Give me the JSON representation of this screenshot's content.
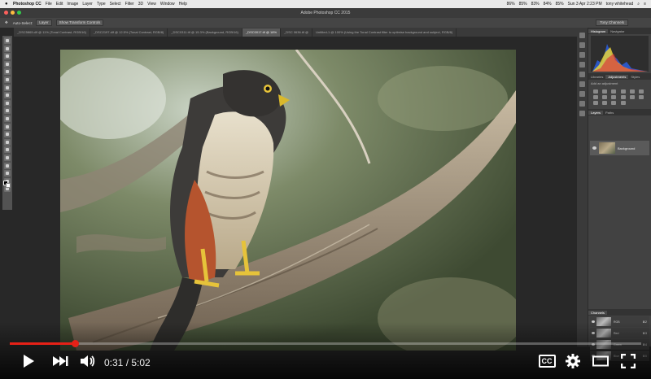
{
  "menubar": {
    "app": "Photoshop CC",
    "items": [
      "File",
      "Edit",
      "Image",
      "Layer",
      "Type",
      "Select",
      "Filter",
      "3D",
      "View",
      "Window",
      "Help"
    ],
    "status": [
      "86%",
      "85%",
      "83%",
      "84%",
      "85%"
    ],
    "clock": "Sun 3 Apr 2:23 PM",
    "user": "tony whitehead"
  },
  "titlebar": {
    "title": "Adobe Photoshop CC 2015"
  },
  "options": {
    "auto_select": "Auto-Select:",
    "layer": "Layer",
    "transform": "Show Transform Controls",
    "workspace": "Tony Channels"
  },
  "tabs": [
    {
      "label": "_DSC5865.dlf @ 11% (Tonal Contrast, RGB/16)",
      "active": false
    },
    {
      "label": "_DSC2197.dlf @ 12.5% (Tonal Contrast, RGB/8)",
      "active": false
    },
    {
      "label": "_DSC0311.tif @ 15.3% (Background, RGB/16)",
      "active": false
    },
    {
      "label": "_DSC0017.tif @ 18%",
      "active": true
    },
    {
      "label": "_DSC 0636.tif @",
      "active": false
    },
    {
      "label": "Untitled-1 @ 100% (Using the Tonal Contrast filter to optimise background and subject, RGB/8)",
      "active": false
    }
  ],
  "panels": {
    "histogram_tabs": [
      "Histogram",
      "Navigator"
    ],
    "adjust_tabs": [
      "Libraries",
      "Adjustments",
      "Styles"
    ],
    "adjust_hint": "Add an adjustment",
    "layer_tabs": [
      "Layers",
      "Paths"
    ],
    "layer_name": "Background",
    "channels_title": "Channels",
    "channels": [
      {
        "name": "RGB",
        "shortcut": "⌘2"
      },
      {
        "name": "Red",
        "shortcut": "⌘3"
      },
      {
        "name": "Green",
        "shortcut": "⌘4"
      },
      {
        "name": "Blue",
        "shortcut": "⌘5"
      }
    ]
  },
  "player": {
    "current_time": "0:31",
    "total_time": "5:02",
    "progress_fraction": 0.1026,
    "cc_label": "CC"
  },
  "colors": {
    "accent": "#e62117"
  }
}
